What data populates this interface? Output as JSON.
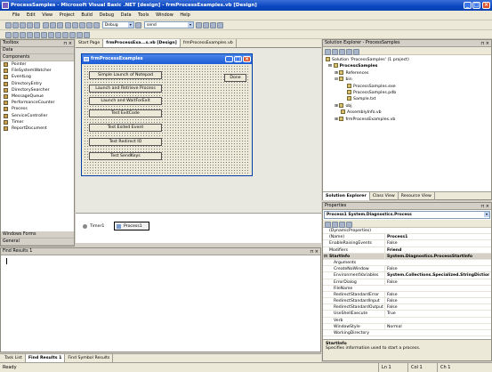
{
  "window": {
    "title": "ProcessSamples - Microsoft Visual Basic .NET [design] - frmProcessExamples.vb [Design]"
  },
  "menu": [
    "File",
    "Edit",
    "View",
    "Project",
    "Build",
    "Debug",
    "Data",
    "Tools",
    "Window",
    "Help"
  ],
  "toolbar": {
    "config": "Debug",
    "find": "send"
  },
  "toolbox": {
    "title": "Toolbox",
    "section_data": "Data",
    "section_components": "Components",
    "items": [
      "Pointer",
      "FileSystemWatcher",
      "EventLog",
      "DirectoryEntry",
      "DirectorySearcher",
      "MessageQueue",
      "PerformanceCounter",
      "Process",
      "ServiceController",
      "Timer",
      "ReportDocument"
    ],
    "section_winforms": "Windows Forms",
    "section_general": "General"
  },
  "doc_tabs": [
    "Start Page",
    "frmProcessExa...s.vb [Design]",
    "frmProcessExamples.vb"
  ],
  "form": {
    "title": "frmProcessExamples",
    "buttons": [
      "Simple Launch of Notepad",
      "Launch and Retrieve Process",
      "Launch and WaitForExit",
      "Test ExitCode",
      "Test Exited Event",
      "Test Redirect IO",
      "Test SendKeys"
    ],
    "done": "Done"
  },
  "tray": {
    "timer": "Timer1",
    "process": "Process1"
  },
  "find": {
    "title": "Find Results 1"
  },
  "bottom_tabs": [
    "Task List",
    "Find Results 1",
    "Find Symbol Results"
  ],
  "solution": {
    "title": "Solution Explorer - ProcessSamples",
    "items": [
      "Solution 'ProcessSamples' (1 project)",
      "ProcessSamples",
      "References",
      "bin",
      "ProcessSamples.exe",
      "ProcessSamples.pdb",
      "Sample.txt",
      "obj",
      "AssemblyInfo.vb",
      "frmProcessExamples.vb"
    ],
    "tabs": [
      "Solution Explorer",
      "Class View",
      "Resource View"
    ]
  },
  "properties": {
    "title": "Properties",
    "object": "Process1  System.Diagnostics.Process",
    "rows": [
      {
        "n": "(DynamicProperties)",
        "v": ""
      },
      {
        "n": "(Name)",
        "v": "Process1"
      },
      {
        "n": "EnableRaisingEvents",
        "v": "False"
      },
      {
        "n": "Modifiers",
        "v": "Friend"
      },
      {
        "n": "StartInfo",
        "v": "System.Diagnostics.ProcessStartInfo"
      },
      {
        "n": "Arguments",
        "v": ""
      },
      {
        "n": "CreateNoWindow",
        "v": "False"
      },
      {
        "n": "EnvironmentVariables",
        "v": "System.Collections.Specialized.StringDictionar"
      },
      {
        "n": "ErrorDialog",
        "v": "False"
      },
      {
        "n": "FileName",
        "v": ""
      },
      {
        "n": "RedirectStandardError",
        "v": "False"
      },
      {
        "n": "RedirectStandardInput",
        "v": "False"
      },
      {
        "n": "RedirectStandardOutput",
        "v": "False"
      },
      {
        "n": "UseShellExecute",
        "v": "True"
      },
      {
        "n": "Verb",
        "v": ""
      },
      {
        "n": "WindowStyle",
        "v": "Normal"
      },
      {
        "n": "WorkingDirectory",
        "v": ""
      }
    ],
    "desc_title": "StartInfo",
    "desc_text": "Specifies information used to start a process."
  },
  "status": {
    "text": "Ready",
    "ln": "Ln 1",
    "col": "Col 1",
    "ch": "Ch 1"
  }
}
